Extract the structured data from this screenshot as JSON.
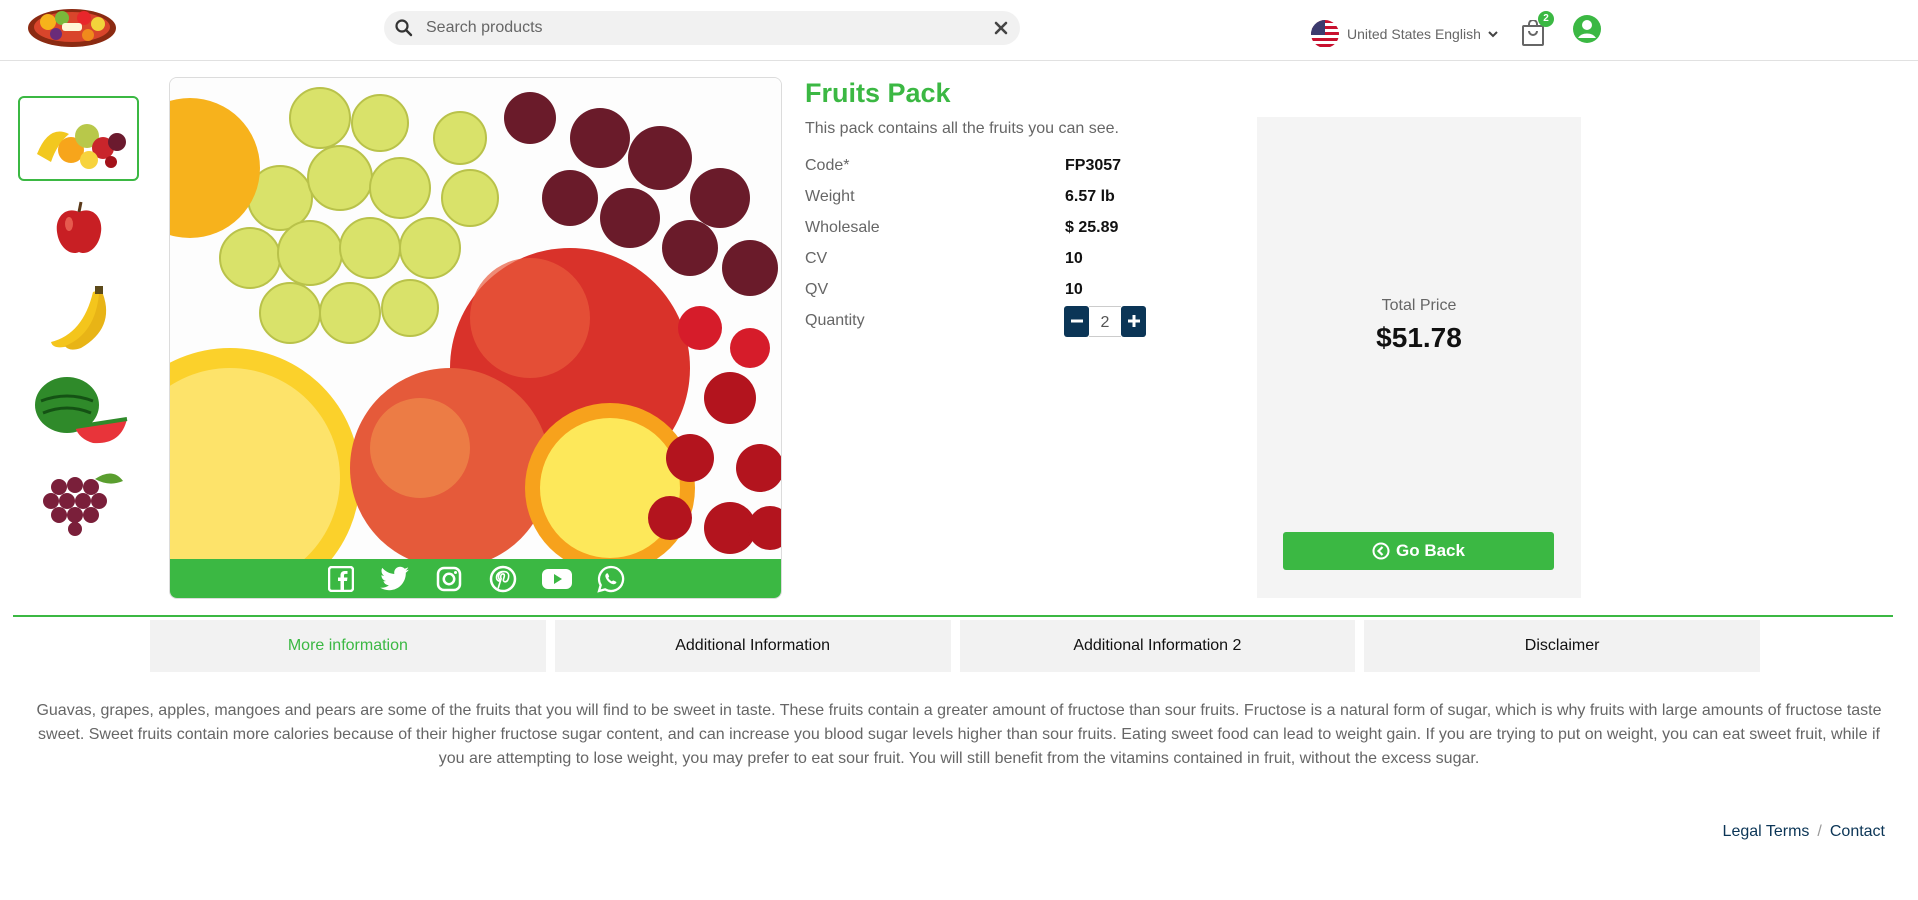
{
  "header": {
    "search_placeholder": "Search products",
    "language_label": "United States English",
    "cart_count": "2"
  },
  "thumbnails": [
    {
      "name": "fruit-mix"
    },
    {
      "name": "apple"
    },
    {
      "name": "banana"
    },
    {
      "name": "watermelon"
    },
    {
      "name": "grapes"
    }
  ],
  "product": {
    "title": "Fruits Pack",
    "description": "This pack contains all the fruits you can see.",
    "specs": [
      {
        "label": "Code*",
        "value": "FP3057"
      },
      {
        "label": "Weight",
        "value": "6.57 lb"
      },
      {
        "label": "Wholesale",
        "value": "$ 25.89"
      },
      {
        "label": "CV",
        "value": "10"
      },
      {
        "label": "QV",
        "value": "10"
      },
      {
        "label": "Quantity",
        "value": ""
      }
    ],
    "quantity": "2"
  },
  "price_panel": {
    "label": "Total Price",
    "value": "$51.78",
    "go_back_label": "Go Back"
  },
  "social_icons": [
    "facebook-icon",
    "twitter-icon",
    "instagram-icon",
    "pinterest-icon",
    "youtube-icon",
    "whatsapp-icon"
  ],
  "tabs": [
    {
      "label": "More information",
      "active": true
    },
    {
      "label": "Additional Information",
      "active": false
    },
    {
      "label": "Additional Information 2",
      "active": false
    },
    {
      "label": "Disclaimer",
      "active": false
    }
  ],
  "info_text": "Guavas, grapes, apples, mangoes and pears are some of the fruits that you will find to be sweet in taste. These fruits contain a greater amount of fructose than sour fruits. Fructose is a natural form of sugar, which is why fruits with large amounts of fructose taste sweet. Sweet fruits contain more calories because of their higher fructose sugar content, and can increase you blood sugar levels higher than sour fruits. Eating sweet food can lead to weight gain. If you are trying to put on weight, you can eat sweet fruit, while if you are attempting to lose weight, you may prefer to eat sour fruit. You will still benefit from the vitamins contained in fruit, without the excess sugar.",
  "footer": {
    "legal": "Legal Terms",
    "separator": "/",
    "contact": "Contact"
  },
  "colors": {
    "accent": "#3bb843",
    "navy": "#0b3556",
    "panel": "#f4f4f4"
  }
}
